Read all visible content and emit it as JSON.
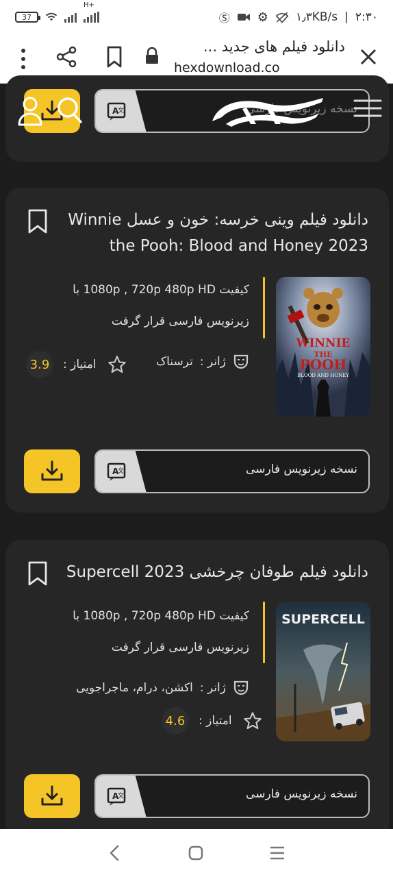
{
  "status_bar": {
    "time": "۲:۳۰",
    "speed": "۱٫۳KB/s",
    "separator": "|",
    "battery": "37",
    "network": "H+"
  },
  "browser": {
    "title": "دانلود فیلم های جدید ...",
    "url": "hexdownload.co"
  },
  "header": {
    "logo": "hex",
    "partial_subtitle_label": "نسخه زیرنویس فارسی"
  },
  "movies": [
    {
      "title": "دانلود فیلم وینی خرسه: خون و عسل Winnie the Pooh: Blood and Honey 2023",
      "quality": "کیفیت 1080p , 720p 480p HD با زیرنویس فارسی قرار گرفت",
      "genre_label": "ژانر :",
      "genre": "ترسناک",
      "rating_label": "امتیاز :",
      "rating": "3.9",
      "subtitle_button": "نسخه زیرنویس فارسی",
      "poster": {
        "line1": "WINNIE",
        "line2": "THE",
        "line3": "POOH",
        "line4": "BLOOD AND HONEY"
      }
    },
    {
      "title": "دانلود فیلم طوفان چرخشی Supercell 2023",
      "quality": "کیفیت 1080p , 720p 480p HD با زیرنویس فارسی قرار گرفت",
      "genre_label": "ژانر :",
      "genre": "اکشن، درام، ماجراجویی",
      "rating_label": "امتیاز :",
      "rating": "4.6",
      "subtitle_button": "نسخه زیرنویس فارسی",
      "poster": {
        "line1": "SUPERCELL"
      }
    }
  ],
  "colors": {
    "accent": "#f5c427",
    "card": "#262626",
    "background": "#1c1c1c"
  }
}
